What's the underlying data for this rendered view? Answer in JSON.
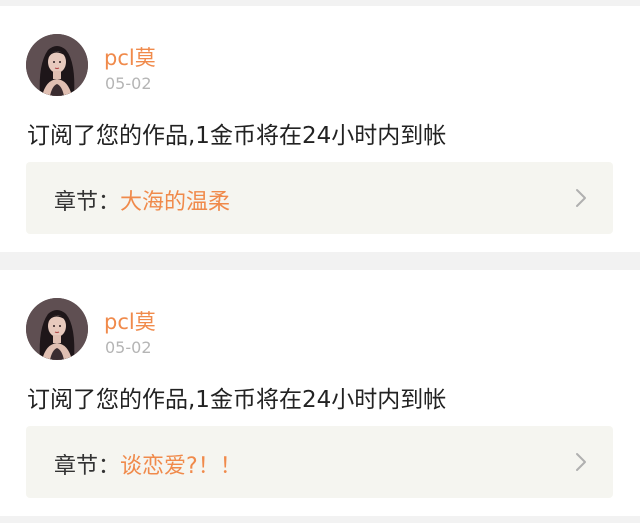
{
  "notifications": [
    {
      "username": "pcl莫",
      "date": "05-02",
      "message": "订阅了您的作品,1金币将在24小时内到帐",
      "chapter_prefix": "章节：",
      "chapter_title": "大海的温柔"
    },
    {
      "username": "pcl莫",
      "date": "05-02",
      "message": "订阅了您的作品,1金币将在24小时内到帐",
      "chapter_prefix": "章节：",
      "chapter_title": "谈恋爱?！！"
    }
  ],
  "colors": {
    "accent": "#f08a4b",
    "date": "#b5b5b5",
    "chapter_bg": "#f5f5f0"
  }
}
